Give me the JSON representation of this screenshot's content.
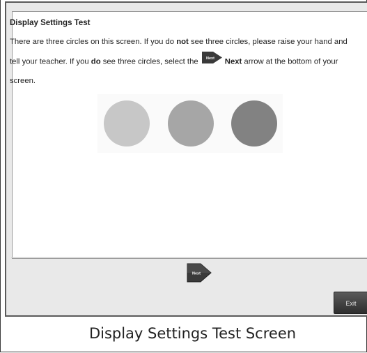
{
  "test": {
    "title": "Display Settings Test",
    "text_1": "There are three circles on this screen. If you do ",
    "text_bold_1": "not",
    "text_2": " see three circles, please raise your hand and tell your teacher. If you ",
    "text_bold_2": "do",
    "text_3": " see three circles, select the ",
    "inline_next_icon_label": "Next",
    "text_bold_3": "Next",
    "text_4": " arrow at the bottom of your screen."
  },
  "circles": {
    "colors": [
      "#c7c7c7",
      "#a6a6a6",
      "#828282"
    ]
  },
  "navigation": {
    "next_label": "Next",
    "exit_label": "Exit"
  },
  "caption": "Display Settings Test Screen",
  "colors": {
    "window_bg": "#e9e9e9",
    "content_bg": "#ffffff",
    "next_arrow_fill": "#3a3a3a",
    "exit_button": "#3d3d3d"
  }
}
